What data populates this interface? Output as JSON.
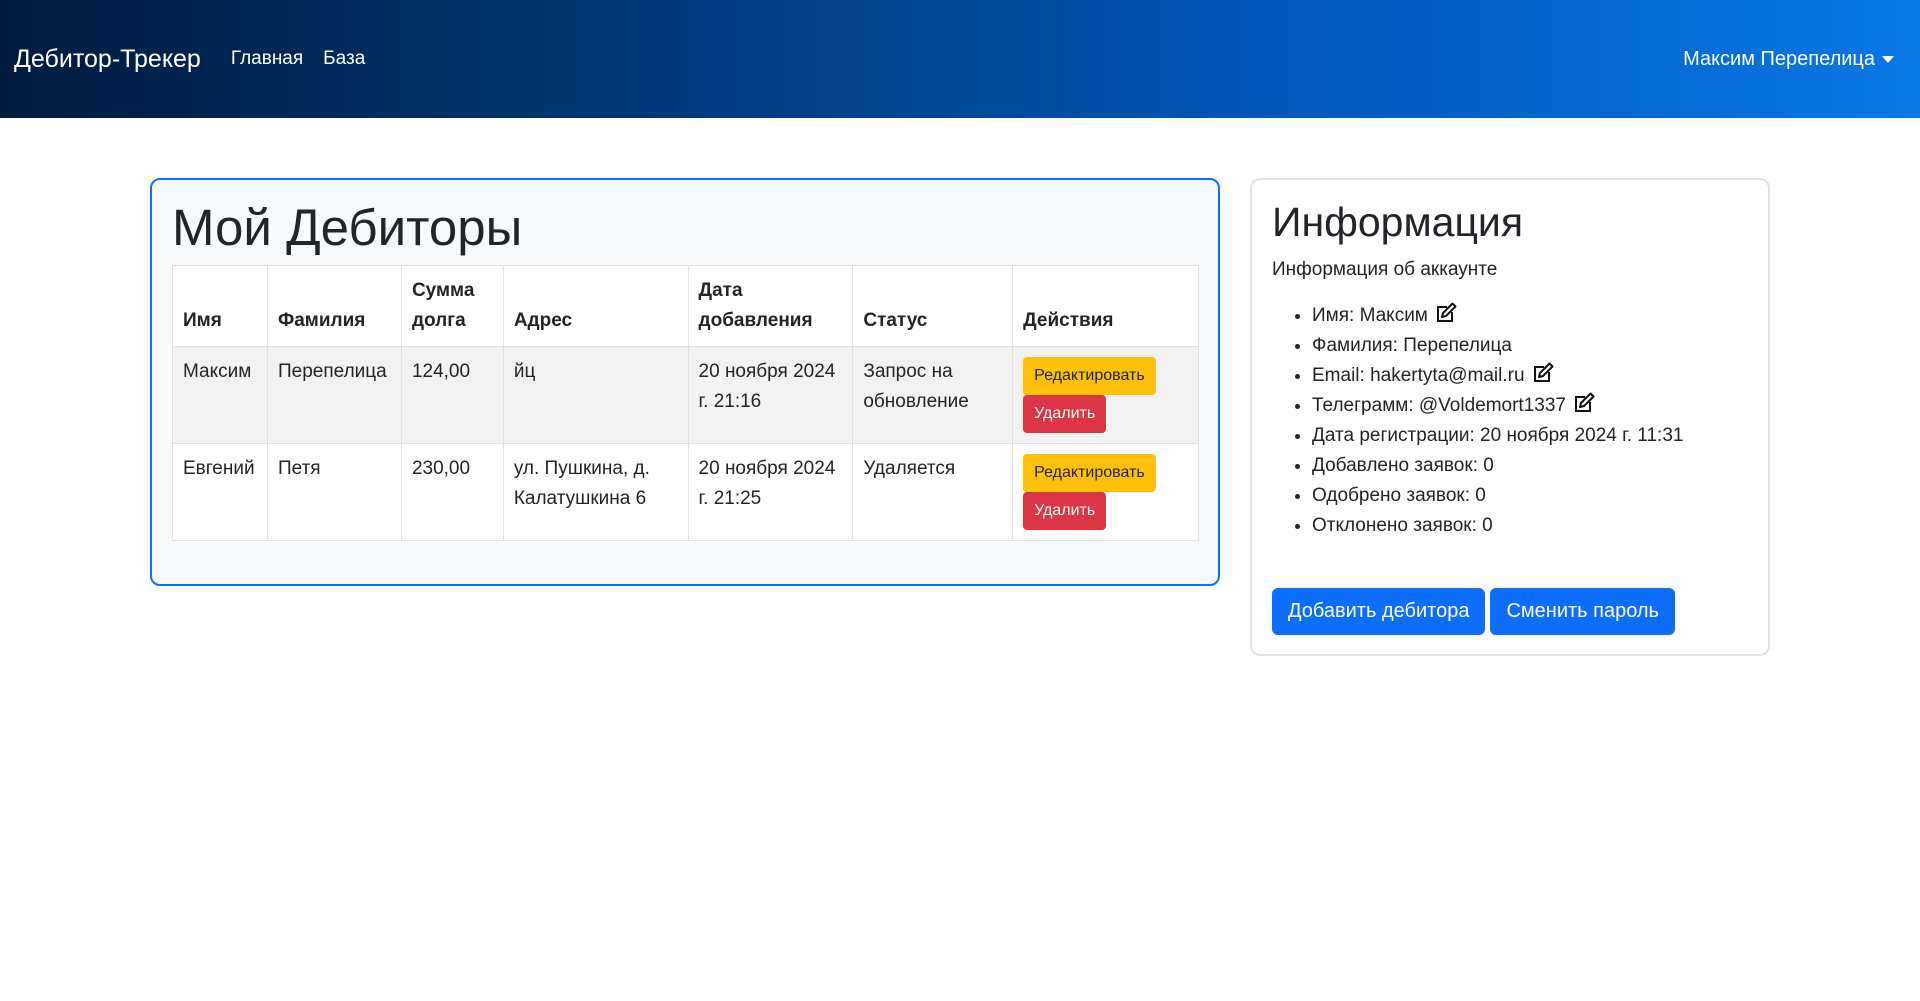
{
  "navbar": {
    "brand": "Дебитор-Трекер",
    "links": [
      "Главная",
      "База"
    ],
    "user": "Максим Перепелица"
  },
  "debtors": {
    "title": "Мой Дебиторы",
    "columns": [
      "Имя",
      "Фамилия",
      "Сумма долга",
      "Адрес",
      "Дата добавления",
      "Статус",
      "Действия"
    ],
    "rows": [
      {
        "first": "Максим",
        "last": "Перепелица",
        "amount": "124,00",
        "address": "йц",
        "date": "20 ноября 2024 г. 21:16",
        "status": "Запрос на обновление"
      },
      {
        "first": "Евгений",
        "last": "Петя",
        "amount": "230,00",
        "address": "ул. Пушкина, д. Калатушкина 6",
        "date": "20 ноября 2024 г. 21:25",
        "status": "Удаляется"
      }
    ],
    "edit_label": "Редактировать",
    "delete_label": "Удалить"
  },
  "info": {
    "title": "Информация",
    "subtitle": "Информация об аккаунте",
    "items": [
      "Имя: Максим",
      "Фамилия: Перепелица",
      "Email: hakertyta@mail.ru",
      "Телеграмм: @Voldemort1337",
      "Дата регистрации: 20 ноября 2024 г. 11:31",
      "Добавлено заявок: 0",
      "Одобрено заявок: 0",
      "Отклонено заявок: 0"
    ],
    "add_debtor_label": "Добавить дебитора",
    "change_password_label": "Сменить пароль"
  },
  "colors": {
    "primary": "#0d6efd",
    "warning": "#ffc107",
    "danger": "#dc3545"
  }
}
